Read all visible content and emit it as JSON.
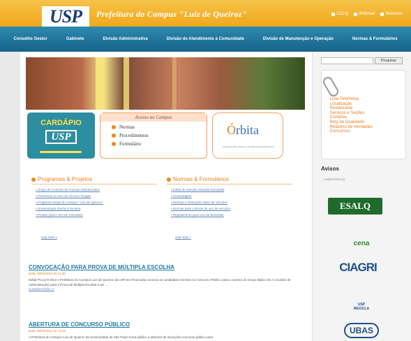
{
  "header": {
    "logo": "USP",
    "site_title": "Prefeitura do Campus \"Luiz de Queiroz\"",
    "top_links": [
      "CCLQ",
      "Webmail",
      "Sistemas"
    ]
  },
  "nav": [
    "Conselho Gestor",
    "Gabinete",
    "Divisão Administrativa",
    "Divisão de Atendimento à Comunidade",
    "Divisão de Manutenção e Operação",
    "Normas & Formulários"
  ],
  "cardapio": {
    "title": "CARDÁPIO",
    "logo": "USP"
  },
  "acesso": {
    "heading": "Acesso ao Campus",
    "items": [
      "Normas",
      "Procedimentos",
      "Formulário"
    ]
  },
  "orbita": {
    "title_a": "Ó",
    "title_b": "rbita",
    "subtitle": "INCUBADORA • ESALQ • DIVISÃO DE INFORMÁTICA"
  },
  "programas": {
    "heading": "Programas & Projetos",
    "items": [
      "Grupo de Controle de Animais Abandonados",
      "Prevenção ao Uso de Álcool e Drogas",
      "Programa Amigo do Campus \"Luiz de Queiroz\"",
      "Universidade Aberta à Terceira",
      "Projeto Quero Ser um Voluntário"
    ],
    "more": "veja mais »"
  },
  "normas": {
    "heading": "Normas & Formulários",
    "items": [
      "Edital de Seleção Moradia Estudantil",
      "Hospedagem",
      "Normas e Instruções Setor de Veículos",
      "Normas para controle de uso de veículos",
      "Regulamento para Uso de Bicicletas"
    ],
    "more": "veja mais »"
  },
  "news": [
    {
      "title": "CONVOCAÇÃO PARA PROVA DE MÚLTIPLA ESCOLHA",
      "date": "Data: 08/03/2012 às 11:30",
      "text": "Edital PCLQ-8-2012 A Prefeitura do Campus Luiz de Queiroz da USP em Piracicaba convoca os candidatos inscritos no Concurso Público para a carreira do Grupo Básico B1 A (Auxiliar de Administração) para a Prova de Múltipla Escolha a ser ...",
      "more": "Continue lendo >>"
    },
    {
      "title": "ABERTURA DE CONCURSO PÚBLICO",
      "date": "Data: 08/03/2012 às 13:15",
      "text": "A Prefeitura do Campus Luiz de Queiroz da Universidade de São Paulo torna público a abertura de inscrições concurso público para"
    }
  ],
  "sidebar": {
    "search_button": "Pesquisar",
    "links": [
      "Lista Telefônica",
      "Localização",
      "Restaurante",
      "Serviços e Seções",
      "Compras",
      "Blog da Qualidade",
      "Relatório de Atividades",
      "Concursos"
    ],
    "avisos_title": "Avisos",
    "avisos_link": "... Avisos ESALQ",
    "logos": {
      "esalq": "ESALQ",
      "cena": "cena",
      "ciagri": "CIAGRI",
      "recicla_a": "USP",
      "recicla_b": "RECICLA",
      "ubas": "UBAS"
    }
  },
  "colors": {
    "orange": "#f0a81a",
    "nav_blue": "#1f7aa3"
  }
}
